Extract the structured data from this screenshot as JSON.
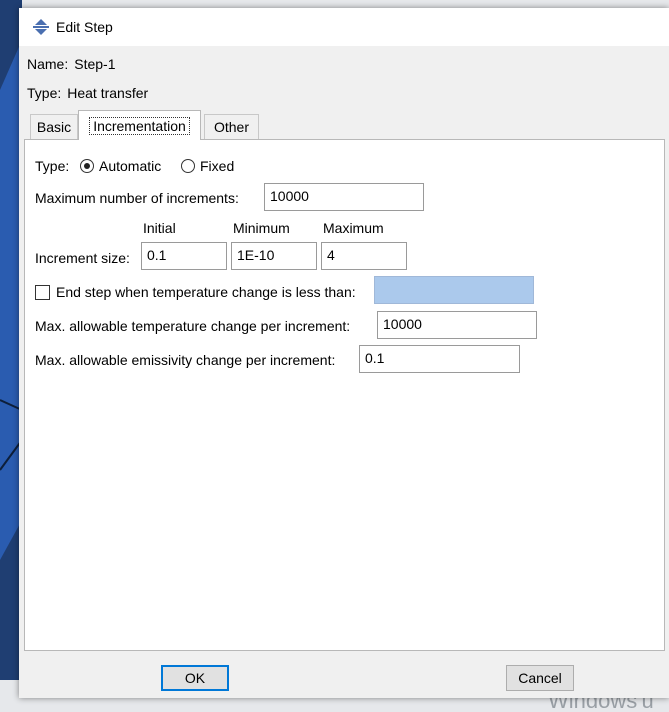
{
  "window": {
    "title": "Edit Step",
    "icon": "step-icon"
  },
  "step": {
    "name_label": "Name:",
    "name_value": "Step-1",
    "type_label": "Type:",
    "type_value": "Heat transfer"
  },
  "tabs": [
    {
      "label": "Basic",
      "active": false
    },
    {
      "label": "Incrementation",
      "active": true
    },
    {
      "label": "Other",
      "active": false
    }
  ],
  "incrementation": {
    "type_label": "Type:",
    "type_options": [
      {
        "label": "Automatic",
        "selected": true
      },
      {
        "label": "Fixed",
        "selected": false
      }
    ],
    "max_increments_label": "Maximum number of increments:",
    "max_increments_value": "10000",
    "col_initial": "Initial",
    "col_minimum": "Minimum",
    "col_maximum": "Maximum",
    "increment_size_label": "Increment size:",
    "increment_initial": "0.1",
    "increment_minimum": "1E-10",
    "increment_maximum": "4",
    "end_step_label": "End step when temperature change is less than:",
    "end_step_checked": false,
    "end_step_value": "",
    "max_temp_change_label": "Max. allowable temperature change per increment:",
    "max_temp_change_value": "10000",
    "max_emissivity_label": "Max. allowable emissivity change per increment:",
    "max_emissivity_value": "0.1"
  },
  "buttons": {
    "ok": "OK",
    "cancel": "Cancel"
  },
  "desktop": {
    "watermark": "Windows'u"
  },
  "colors": {
    "accent": "#0078d7",
    "disabled_field": "#abc9ec",
    "background_shape": "#1e3f78"
  }
}
